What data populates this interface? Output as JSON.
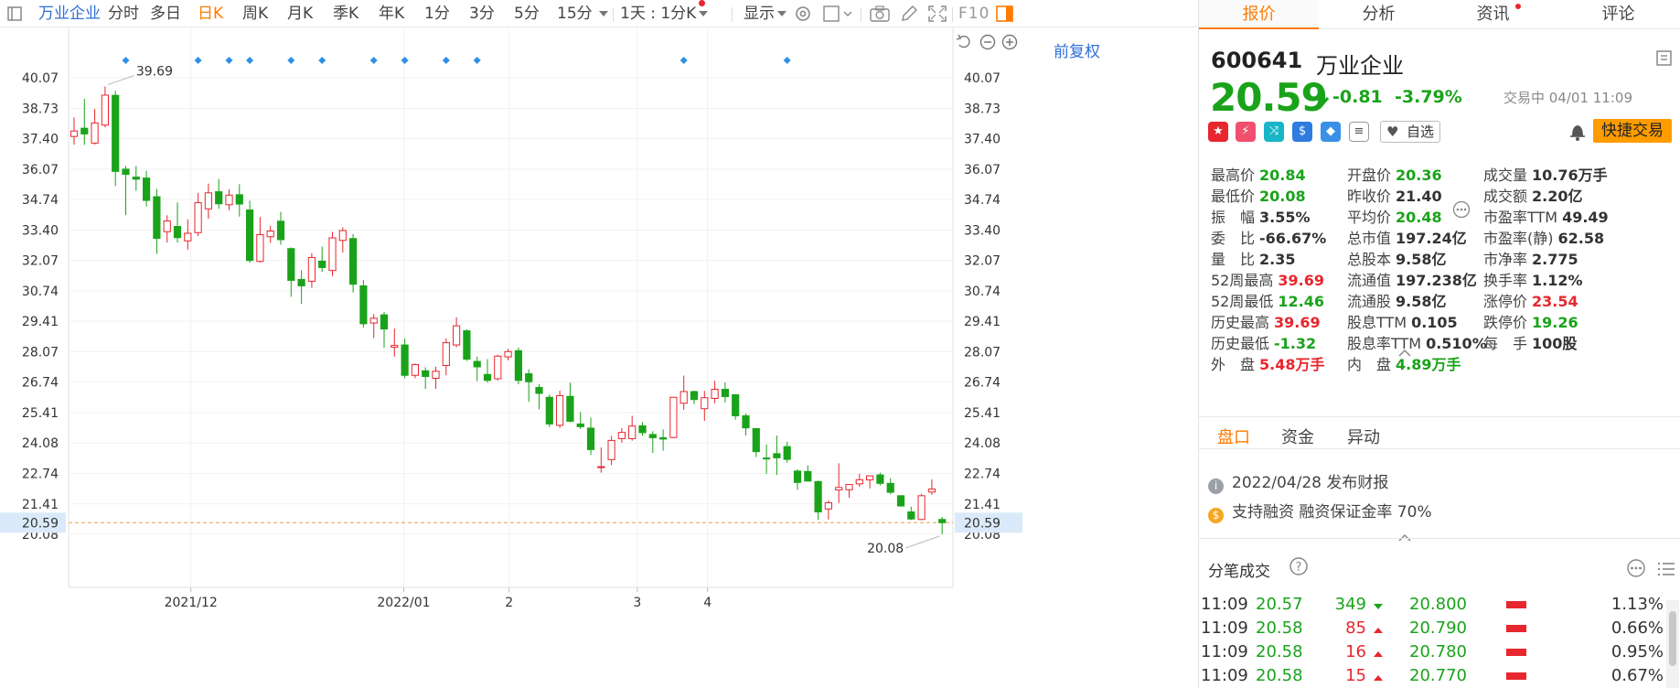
{
  "toolbar": {
    "stock_name": "万业企业",
    "periods": [
      "分时",
      "多日",
      "日K",
      "周K",
      "月K",
      "季K",
      "年K",
      "1分",
      "3分",
      "5分",
      "15分"
    ],
    "active_period": "日K",
    "interval": "1天 : 1分K",
    "display": "显示",
    "f10": "F10"
  },
  "chart": {
    "adjust": "前复权",
    "y_ticks": [
      "40.07",
      "38.73",
      "37.40",
      "36.07",
      "34.74",
      "33.40",
      "32.07",
      "30.74",
      "29.41",
      "28.07",
      "26.74",
      "25.41",
      "24.08",
      "22.74",
      "21.41",
      "20.08"
    ],
    "current_price": "20.59",
    "high_label": "39.69",
    "low_label": "20.08",
    "event_markers": [
      6,
      13,
      16,
      18,
      22,
      25,
      30,
      33,
      37,
      40,
      60,
      70
    ]
  },
  "chart_data": {
    "type": "candlestick",
    "title": "",
    "xlabel": "",
    "ylabel": "",
    "ylim": [
      19.4,
      41.4
    ],
    "y_ticks": [
      40.07,
      38.73,
      37.4,
      36.07,
      34.74,
      33.4,
      32.07,
      30.74,
      29.41,
      28.07,
      26.74,
      25.41,
      24.08,
      22.74,
      21.41,
      20.08
    ],
    "x_ticks": [
      {
        "label": "2021/12",
        "at": 12.3
      },
      {
        "label": "2022/01",
        "at": 32.9
      },
      {
        "label": "2",
        "at": 43.1
      },
      {
        "label": "3",
        "at": 55.5
      },
      {
        "label": "4",
        "at": 62.3
      }
    ],
    "colors": {
      "up": "#e8262d",
      "down": "#1aa31a"
    },
    "candles": [
      {
        "x": 1,
        "open": 37.5,
        "high": 38.33,
        "low": 37.14,
        "close": 37.74
      },
      {
        "x": 2,
        "open": 37.86,
        "high": 39.15,
        "low": 37.13,
        "close": 37.61
      },
      {
        "x": 3,
        "open": 37.21,
        "high": 38.7,
        "low": 37.14,
        "close": 38.09
      },
      {
        "x": 4,
        "open": 38.0,
        "high": 39.69,
        "low": 37.9,
        "close": 39.31
      },
      {
        "x": 5,
        "open": 39.3,
        "high": 39.5,
        "low": 35.33,
        "close": 35.97
      },
      {
        "x": 6,
        "open": 36.07,
        "high": 36.21,
        "low": 34.06,
        "close": 35.84
      },
      {
        "x": 7,
        "open": 35.72,
        "high": 36.21,
        "low": 35.12,
        "close": 35.63
      },
      {
        "x": 8,
        "open": 35.68,
        "high": 36.0,
        "low": 34.43,
        "close": 34.7
      },
      {
        "x": 9,
        "open": 34.86,
        "high": 35.2,
        "low": 32.36,
        "close": 33.04
      },
      {
        "x": 10,
        "open": 33.33,
        "high": 34.05,
        "low": 32.86,
        "close": 33.8
      },
      {
        "x": 11,
        "open": 33.56,
        "high": 34.61,
        "low": 32.86,
        "close": 33.07
      },
      {
        "x": 12,
        "open": 32.93,
        "high": 33.87,
        "low": 32.54,
        "close": 33.26
      },
      {
        "x": 13,
        "open": 33.29,
        "high": 35.03,
        "low": 33.14,
        "close": 34.6
      },
      {
        "x": 14,
        "open": 34.33,
        "high": 35.44,
        "low": 33.89,
        "close": 35.03
      },
      {
        "x": 15,
        "open": 35.08,
        "high": 35.64,
        "low": 34.33,
        "close": 34.55
      },
      {
        "x": 16,
        "open": 34.51,
        "high": 35.18,
        "low": 34.27,
        "close": 34.93
      },
      {
        "x": 17,
        "open": 34.95,
        "high": 35.41,
        "low": 33.99,
        "close": 34.54
      },
      {
        "x": 18,
        "open": 34.28,
        "high": 34.69,
        "low": 31.97,
        "close": 32.07
      },
      {
        "x": 19,
        "open": 32.03,
        "high": 33.97,
        "low": 31.98,
        "close": 33.2
      },
      {
        "x": 20,
        "open": 33.11,
        "high": 33.59,
        "low": 32.84,
        "close": 33.36
      },
      {
        "x": 21,
        "open": 33.79,
        "high": 34.2,
        "low": 32.76,
        "close": 32.98
      },
      {
        "x": 22,
        "open": 32.59,
        "high": 32.64,
        "low": 30.48,
        "close": 31.2
      },
      {
        "x": 23,
        "open": 31.24,
        "high": 31.64,
        "low": 30.17,
        "close": 30.96
      },
      {
        "x": 24,
        "open": 31.16,
        "high": 32.39,
        "low": 30.87,
        "close": 32.2
      },
      {
        "x": 25,
        "open": 32.04,
        "high": 32.68,
        "low": 31.57,
        "close": 31.76
      },
      {
        "x": 26,
        "open": 31.63,
        "high": 33.32,
        "low": 31.39,
        "close": 33.06
      },
      {
        "x": 27,
        "open": 32.95,
        "high": 33.52,
        "low": 32.42,
        "close": 33.38
      },
      {
        "x": 28,
        "open": 33.03,
        "high": 33.23,
        "low": 30.67,
        "close": 31.03
      },
      {
        "x": 29,
        "open": 30.96,
        "high": 31.21,
        "low": 29.13,
        "close": 29.3
      },
      {
        "x": 30,
        "open": 29.33,
        "high": 29.72,
        "low": 28.67,
        "close": 29.54
      },
      {
        "x": 31,
        "open": 29.69,
        "high": 29.82,
        "low": 28.25,
        "close": 29.07
      },
      {
        "x": 32,
        "open": 28.27,
        "high": 29.09,
        "low": 27.86,
        "close": 28.35
      },
      {
        "x": 33,
        "open": 28.37,
        "high": 28.65,
        "low": 26.91,
        "close": 27.04
      },
      {
        "x": 34,
        "open": 27.04,
        "high": 27.56,
        "low": 26.91,
        "close": 27.51
      },
      {
        "x": 35,
        "open": 27.24,
        "high": 27.39,
        "low": 26.44,
        "close": 26.99
      },
      {
        "x": 36,
        "open": 26.91,
        "high": 27.42,
        "low": 26.45,
        "close": 27.22
      },
      {
        "x": 37,
        "open": 27.47,
        "high": 28.65,
        "low": 27.04,
        "close": 28.47
      },
      {
        "x": 38,
        "open": 28.37,
        "high": 29.58,
        "low": 28.27,
        "close": 29.21
      },
      {
        "x": 39,
        "open": 28.99,
        "high": 29.06,
        "low": 27.67,
        "close": 27.75
      },
      {
        "x": 40,
        "open": 27.65,
        "high": 27.86,
        "low": 26.79,
        "close": 27.41
      },
      {
        "x": 41,
        "open": 27.08,
        "high": 27.75,
        "low": 26.72,
        "close": 26.82
      },
      {
        "x": 42,
        "open": 26.89,
        "high": 27.95,
        "low": 26.82,
        "close": 27.88
      },
      {
        "x": 43,
        "open": 27.85,
        "high": 28.2,
        "low": 27.7,
        "close": 28.08
      },
      {
        "x": 44,
        "open": 28.12,
        "high": 28.26,
        "low": 26.65,
        "close": 26.82
      },
      {
        "x": 45,
        "open": 27.11,
        "high": 27.3,
        "low": 25.88,
        "close": 26.76
      },
      {
        "x": 46,
        "open": 26.51,
        "high": 26.66,
        "low": 25.55,
        "close": 26.25
      },
      {
        "x": 47,
        "open": 26.08,
        "high": 26.2,
        "low": 24.78,
        "close": 24.91
      },
      {
        "x": 48,
        "open": 24.85,
        "high": 26.37,
        "low": 24.74,
        "close": 26.15
      },
      {
        "x": 49,
        "open": 26.12,
        "high": 26.72,
        "low": 24.98,
        "close": 25.03
      },
      {
        "x": 50,
        "open": 24.91,
        "high": 25.43,
        "low": 24.69,
        "close": 24.79
      },
      {
        "x": 51,
        "open": 24.73,
        "high": 25.19,
        "low": 23.56,
        "close": 23.79
      },
      {
        "x": 52,
        "open": 23.04,
        "high": 23.88,
        "low": 22.78,
        "close": 23.04
      },
      {
        "x": 53,
        "open": 23.35,
        "high": 24.38,
        "low": 23.11,
        "close": 24.19
      },
      {
        "x": 54,
        "open": 24.27,
        "high": 24.73,
        "low": 24.09,
        "close": 24.54
      },
      {
        "x": 55,
        "open": 24.27,
        "high": 25.27,
        "low": 24.18,
        "close": 24.82
      },
      {
        "x": 56,
        "open": 24.83,
        "high": 24.99,
        "low": 24.39,
        "close": 24.53
      },
      {
        "x": 57,
        "open": 24.45,
        "high": 24.59,
        "low": 23.64,
        "close": 24.31
      },
      {
        "x": 58,
        "open": 24.31,
        "high": 24.67,
        "low": 23.74,
        "close": 24.25
      },
      {
        "x": 59,
        "open": 24.32,
        "high": 26.06,
        "low": 24.29,
        "close": 26.08
      },
      {
        "x": 60,
        "open": 25.82,
        "high": 27.03,
        "low": 25.53,
        "close": 26.33
      },
      {
        "x": 61,
        "open": 26.33,
        "high": 26.37,
        "low": 25.78,
        "close": 25.98
      },
      {
        "x": 62,
        "open": 25.58,
        "high": 26.36,
        "low": 25.05,
        "close": 26.06
      },
      {
        "x": 63,
        "open": 26.03,
        "high": 26.8,
        "low": 25.82,
        "close": 26.43
      },
      {
        "x": 64,
        "open": 26.43,
        "high": 26.73,
        "low": 25.85,
        "close": 26.11
      },
      {
        "x": 65,
        "open": 26.19,
        "high": 26.22,
        "low": 25.1,
        "close": 25.27
      },
      {
        "x": 66,
        "open": 25.27,
        "high": 25.37,
        "low": 24.4,
        "close": 24.74
      },
      {
        "x": 67,
        "open": 24.71,
        "high": 24.71,
        "low": 23.46,
        "close": 23.7
      },
      {
        "x": 68,
        "open": 23.42,
        "high": 24.01,
        "low": 22.73,
        "close": 23.41
      },
      {
        "x": 69,
        "open": 23.61,
        "high": 24.4,
        "low": 22.68,
        "close": 23.43
      },
      {
        "x": 70,
        "open": 23.92,
        "high": 24.14,
        "low": 23.21,
        "close": 23.36
      },
      {
        "x": 71,
        "open": 22.85,
        "high": 22.92,
        "low": 22.03,
        "close": 22.35
      },
      {
        "x": 72,
        "open": 22.83,
        "high": 23.1,
        "low": 22.55,
        "close": 22.41
      },
      {
        "x": 73,
        "open": 22.39,
        "high": 22.43,
        "low": 20.71,
        "close": 21.06
      },
      {
        "x": 74,
        "open": 21.19,
        "high": 21.57,
        "low": 20.73,
        "close": 21.46
      },
      {
        "x": 75,
        "open": 22.02,
        "high": 23.19,
        "low": 21.45,
        "close": 22.13
      },
      {
        "x": 76,
        "open": 22.03,
        "high": 22.27,
        "low": 21.68,
        "close": 22.26
      },
      {
        "x": 77,
        "open": 22.29,
        "high": 22.73,
        "low": 22.16,
        "close": 22.47
      },
      {
        "x": 78,
        "open": 22.46,
        "high": 22.66,
        "low": 22.09,
        "close": 22.64
      },
      {
        "x": 79,
        "open": 22.68,
        "high": 22.78,
        "low": 22.22,
        "close": 22.31
      },
      {
        "x": 80,
        "open": 22.31,
        "high": 22.54,
        "low": 21.83,
        "close": 21.92
      },
      {
        "x": 81,
        "open": 21.77,
        "high": 21.79,
        "low": 21.29,
        "close": 21.32
      },
      {
        "x": 82,
        "open": 21.06,
        "high": 21.29,
        "low": 20.7,
        "close": 20.75
      },
      {
        "x": 83,
        "open": 20.73,
        "high": 21.86,
        "low": 20.7,
        "close": 21.77
      },
      {
        "x": 84,
        "open": 21.93,
        "high": 22.48,
        "low": 21.81,
        "close": 22.06
      },
      {
        "x": 85,
        "open": 20.73,
        "high": 20.84,
        "low": 20.08,
        "close": 20.59
      }
    ]
  },
  "panel": {
    "tabs": [
      "报价",
      "分析",
      "资讯",
      "评论"
    ],
    "active_tab": "报价",
    "code": "600641",
    "name": "万业企业",
    "price": "20.59",
    "change": "-0.81",
    "change_pct": "-3.79%",
    "trade_status": "交易中 04/01 11:09",
    "add_watch": "自选",
    "fast_trade": "快捷交易",
    "stats": [
      [
        {
          "k": "最高价",
          "v": "20.84",
          "c": "g"
        },
        {
          "k": "开盘价",
          "v": "20.36",
          "c": "g"
        },
        {
          "k": "成交量",
          "v": "10.76万手",
          "c": "d"
        }
      ],
      [
        {
          "k": "最低价",
          "v": "20.08",
          "c": "g"
        },
        {
          "k": "昨收价",
          "v": "21.40",
          "c": "d"
        },
        {
          "k": "成交额",
          "v": "2.20亿",
          "c": "d"
        }
      ],
      [
        {
          "k": "振　幅",
          "v": "3.55%",
          "c": "d"
        },
        {
          "k": "平均价",
          "v": "20.48",
          "c": "g"
        },
        {
          "k": "市盈率TTM",
          "v": "49.49",
          "c": "d"
        }
      ],
      [
        {
          "k": "委　比",
          "v": "-66.67%",
          "c": "d"
        },
        {
          "k": "总市值",
          "v": "197.24亿",
          "c": "d"
        },
        {
          "k": "市盈率(静)",
          "v": "62.58",
          "c": "d"
        }
      ],
      [
        {
          "k": "量　比",
          "v": "2.35",
          "c": "d"
        },
        {
          "k": "总股本",
          "v": "9.58亿",
          "c": "d"
        },
        {
          "k": "市净率",
          "v": "2.775",
          "c": "d"
        }
      ],
      [
        {
          "k": "52周最高",
          "v": "39.69",
          "c": "r"
        },
        {
          "k": "流通值",
          "v": "197.238亿",
          "c": "d"
        },
        {
          "k": "换手率",
          "v": "1.12%",
          "c": "d"
        }
      ],
      [
        {
          "k": "52周最低",
          "v": "12.46",
          "c": "g"
        },
        {
          "k": "流通股",
          "v": "9.58亿",
          "c": "d"
        },
        {
          "k": "涨停价",
          "v": "23.54",
          "c": "r"
        }
      ],
      [
        {
          "k": "历史最高",
          "v": "39.69",
          "c": "r"
        },
        {
          "k": "股息TTM",
          "v": "0.105",
          "c": "d"
        },
        {
          "k": "跌停价",
          "v": "19.26",
          "c": "g"
        }
      ],
      [
        {
          "k": "历史最低",
          "v": "-1.32",
          "c": "g"
        },
        {
          "k": "股息率TTM",
          "v": "0.510%",
          "c": "d"
        },
        {
          "k": "每　手",
          "v": "100股",
          "c": "d"
        }
      ],
      [
        {
          "k": "外　盘",
          "v": "5.48万手",
          "c": "r"
        },
        {
          "k": "内　盘",
          "v": "4.89万手",
          "c": "g"
        }
      ]
    ],
    "subtabs": [
      "盘口",
      "资金",
      "异动"
    ],
    "active_subtab": "盘口",
    "news": [
      {
        "icon": "i",
        "text": "2022/04/28 发布财报"
      },
      {
        "icon": "$",
        "text": "支持融资 融资保证金率 70%"
      }
    ],
    "trade_title": "分笔成交",
    "trades": [
      {
        "time": "11:09",
        "price": "20.57",
        "vol": "349",
        "dir": "down",
        "bid": "20.800",
        "pct": "1.13%"
      },
      {
        "time": "11:09",
        "price": "20.58",
        "vol": "85",
        "dir": "up",
        "bid": "20.790",
        "pct": "0.66%"
      },
      {
        "time": "11:09",
        "price": "20.58",
        "vol": "16",
        "dir": "up",
        "bid": "20.780",
        "pct": "0.95%"
      },
      {
        "time": "11:09",
        "price": "20.58",
        "vol": "15",
        "dir": "up",
        "bid": "20.770",
        "pct": "0.67%"
      }
    ]
  }
}
